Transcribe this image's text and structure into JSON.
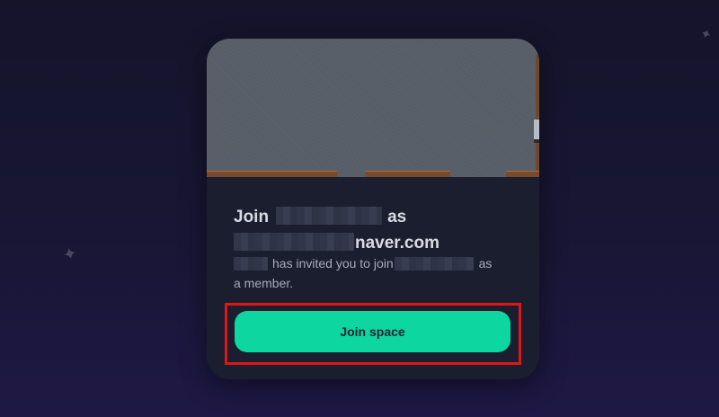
{
  "invite": {
    "join_word": "Join",
    "as_word": "as",
    "email_suffix": "naver.com",
    "invited_text": "has invited you to join",
    "as_member_prefix": "as",
    "as_member_suffix": "a member."
  },
  "button": {
    "label": "Join space"
  },
  "colors": {
    "background": "#181634",
    "card": "#1a1e2e",
    "button": "#0ed6a0",
    "highlight": "#e01616"
  },
  "icons": {
    "decorations": [
      "sparkle-icon",
      "sparkle-icon"
    ]
  }
}
